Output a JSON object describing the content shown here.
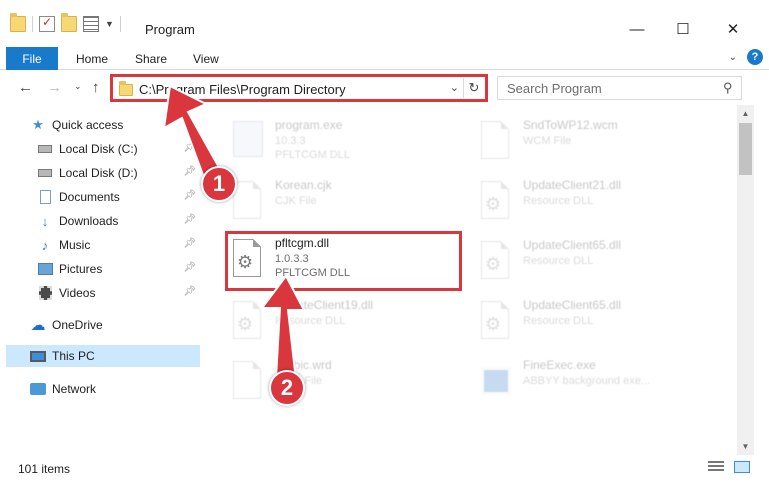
{
  "window": {
    "title": "Program",
    "controls": {
      "minimize": "—",
      "maximize": "☐",
      "close": "✕"
    }
  },
  "ribbon": {
    "tabs": [
      "File",
      "Home",
      "Share",
      "View"
    ],
    "help": "?"
  },
  "address": {
    "path": "C:\\Program Files\\Program Directory",
    "search_placeholder": "Search Program"
  },
  "sidebar": {
    "quick_access": "Quick access",
    "items": [
      {
        "label": "Local Disk (C:)",
        "icon": "disk-icon"
      },
      {
        "label": "Local Disk (D:)",
        "icon": "disk-icon"
      },
      {
        "label": "Documents",
        "icon": "documents-icon"
      },
      {
        "label": "Downloads",
        "icon": "downloads-icon"
      },
      {
        "label": "Music",
        "icon": "music-icon"
      },
      {
        "label": "Pictures",
        "icon": "pictures-icon"
      },
      {
        "label": "Videos",
        "icon": "videos-icon"
      }
    ],
    "onedrive": "OneDrive",
    "this_pc": "This PC",
    "network": "Network"
  },
  "files": [
    {
      "name": "program.exe",
      "line1": "10.3.3",
      "line2": "PFLTCGM DLL",
      "icon": "exe-icon"
    },
    {
      "name": "SndToWP12.wcm",
      "line1": "WCM File",
      "line2": "",
      "icon": "document-icon"
    },
    {
      "name": "Korean.cjk",
      "line1": "CJK File",
      "line2": "",
      "icon": "document-icon"
    },
    {
      "name": "UpdateClient21.dll",
      "line1": "Resource DLL",
      "line2": "",
      "icon": "dll-gear-icon"
    },
    {
      "name": "pfltcgm.dll",
      "line1": "1.0.3.3",
      "line2": "PFLTCGM DLL",
      "icon": "dll-gear-icon"
    },
    {
      "name": "UpdateClient65.dll",
      "line1": "Resource DLL",
      "line2": "",
      "icon": "dll-gear-icon"
    },
    {
      "name": "UpdateClient19.dll",
      "line1": "Resource DLL",
      "line2": "",
      "icon": "dll-gear-icon"
    },
    {
      "name": "UpdateClient65.dll",
      "line1": "Resource DLL",
      "line2": "",
      "icon": "dll-gear-icon"
    },
    {
      "name": "Arabic.wrd",
      "line1": "WRD File",
      "line2": "",
      "icon": "document-icon"
    },
    {
      "name": "FineExec.exe",
      "line1": "ABBYY background exe...",
      "line2": "",
      "icon": "app-icon"
    }
  ],
  "status": {
    "item_count": "101 items"
  },
  "annotations": {
    "step1": "1",
    "step2": "2",
    "color": "#d9363e"
  }
}
